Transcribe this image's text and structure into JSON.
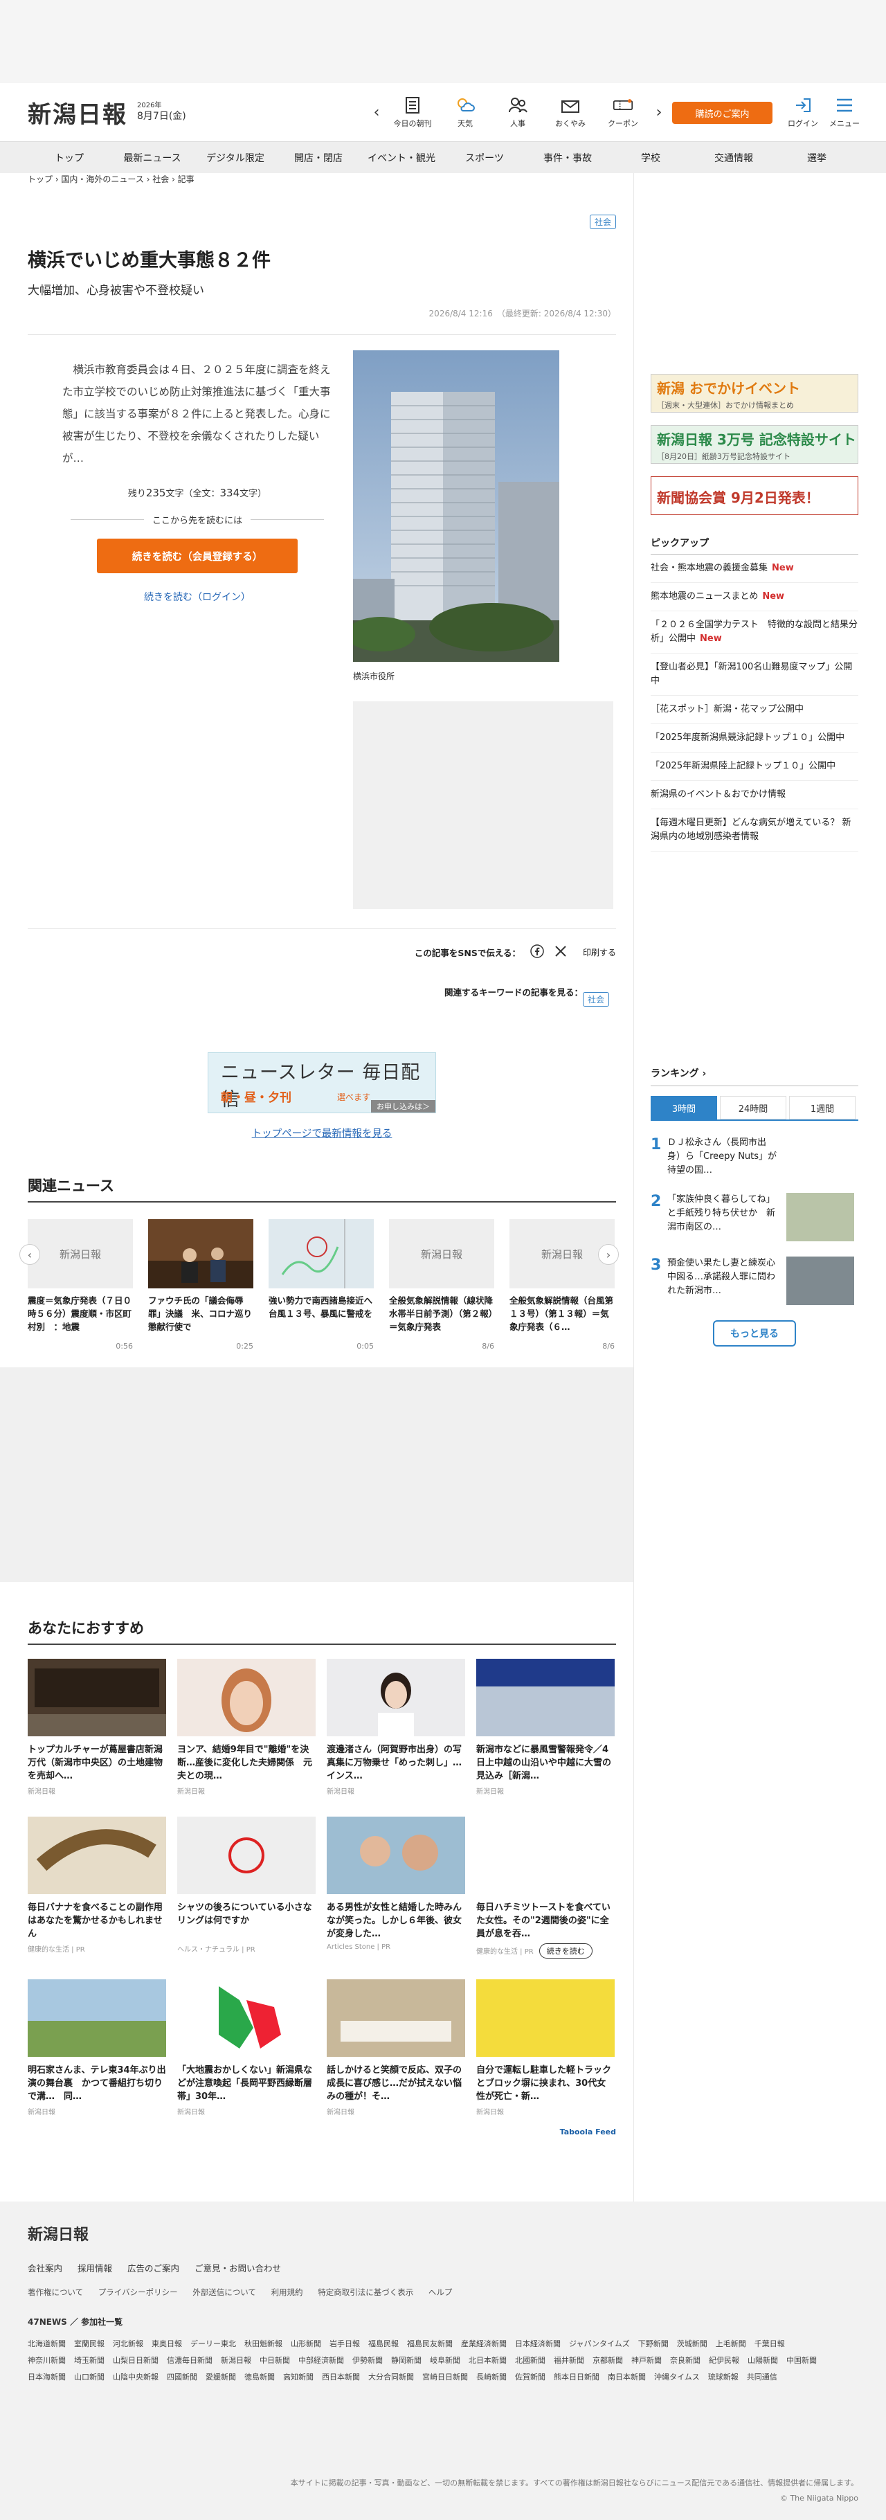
{
  "header": {
    "logo": "新潟日報",
    "date_year": "2026年",
    "date_day": "8月7日(金)",
    "icons": [
      {
        "label": "今日の朝刊",
        "icon": "newspaper-icon"
      },
      {
        "label": "天気",
        "icon": "weather-icon"
      },
      {
        "label": "人事",
        "icon": "people-icon"
      },
      {
        "label": "おくやみ",
        "icon": "mail-icon"
      },
      {
        "label": "クーポン",
        "icon": "coupon-icon"
      }
    ],
    "subscribe": "購読のご案内",
    "login": "ログイン",
    "menu": "メニュー",
    "accent": "#ee6c12"
  },
  "nav": [
    "トップ",
    "最新ニュース",
    "デジタル限定",
    "開店・閉店",
    "イベント・観光",
    "スポーツ",
    "事件・事故",
    "学校",
    "交通情報",
    "選挙"
  ],
  "article": {
    "breadcrumb": "トップ › 国内・海外のニュース › 社会 › 記事",
    "category": "社会",
    "title": "横浜でいじめ重大事態８２件",
    "subtitle": "大幅増加、心身被害や不登校疑い",
    "published": "2026/8/4 12:16　（最終更新: 2026/8/4 12:30）",
    "lead": "横浜市教育委員会は４日、２０２５年度に調査を終えた市立学校でのいじめ防止対策推進法に基づく「重大事態」に該当する事案が８２件に上ると発表した。心身に被害が生じたり、不登校を余儀なくされたりした疑いが…",
    "count_prefix": "残り",
    "count_remaining": "235",
    "count_mid": "文字（全文：",
    "count_total": "334",
    "count_suffix": "文字）",
    "read_more_label": "ここから先を読むには",
    "register_button": "続きを読む（会員登録する）",
    "login_button": "続きを読む（ログイン）",
    "photo_caption": "横浜市役所",
    "sns_label": "この記事をSNSで伝える：",
    "print_label": "印刷する",
    "keyword_label": "関連するキーワードの記事を見る：",
    "keyword": "社会"
  },
  "newsletter": {
    "title": "ニュースレター 毎日配信",
    "times": "朝・昼・夕刊",
    "choose": "選べます",
    "apply": "お申し込みは＞"
  },
  "top_link": "トップページで最新情報を見る",
  "related": {
    "title": "関連ニュース",
    "cards": [
      {
        "thumb": "新潟日報",
        "title": "震度＝気象庁発表（７日０時５６分）震度順・市区町村別　：地震",
        "time": "0:56"
      },
      {
        "thumb": "",
        "title": "ファウチ氏の「議会侮辱罪」決議　米、コロナ巡り懲献行使で",
        "time": "0:25"
      },
      {
        "thumb": "",
        "title": "強い勢力で南西諸島接近へ　台風１３号、暴風に警戒を",
        "time": "0:05"
      },
      {
        "thumb": "新潟日報",
        "title": "全般気象解説情報（線状降水帯半日前予測）（第２報）＝気象庁発表",
        "time": "8/6"
      },
      {
        "thumb": "新潟日報",
        "title": "全般気象解説情報（台風第１３号）（第１３報）＝気象庁発表（６…",
        "time": "8/6"
      }
    ]
  },
  "sidebar": {
    "banners": [
      {
        "main": "新潟 おでかけイベント",
        "sub": "［週末・大型連休］おでかけ情報まとめ"
      },
      {
        "main": "新潟日報 3万号 記念特設サイト",
        "sub": "［8月20日］紙齢3万号記念特設サイト"
      },
      {
        "main": "新聞協会賞 9月2日発表！",
        "sub": ""
      }
    ],
    "pickup_title": "ピックアップ",
    "pickup": [
      {
        "text": "社会・熊本地震の義援金募集",
        "new": "New"
      },
      {
        "text": "熊本地震のニュースまとめ",
        "new": "New"
      },
      {
        "text": "「２０２６全国学力テスト　特徴的な設問と結果分析」公開中",
        "new": "New"
      },
      {
        "text": "【登山者必見】「新潟100名山難易度マップ」公開中",
        "new": ""
      },
      {
        "text": "［花スポット］新潟・花マップ公開中",
        "new": ""
      },
      {
        "text": "「2025年度新潟県競泳記録トップ１０」公開中",
        "new": ""
      },
      {
        "text": "「2025年新潟県陸上記録トップ１０」公開中",
        "new": ""
      },
      {
        "text": "新潟県のイベント＆おでかけ情報",
        "new": ""
      },
      {
        "text": "【毎週木曜日更新】どんな病気が増えている？ 新潟県内の地域別感染者情報",
        "new": ""
      }
    ],
    "ranking_title": "ランキング ›",
    "ranking_tabs": [
      "3時間",
      "24時間",
      "1週間"
    ],
    "ranking": [
      {
        "num": "1",
        "text": "ＤＪ松永さん（長岡市出身）ら「Creepy Nuts」が待望の国…"
      },
      {
        "num": "2",
        "text": "「家族仲良く暮らしてね」と手紙残り特ち伏せか　新潟市南区の…"
      },
      {
        "num": "3",
        "text": "預金使い果たし妻と練炭心中図る…承諾殺人罪に問われた新潟市…"
      }
    ],
    "more_button": "もっと見る"
  },
  "recommend": {
    "title": "あなたにおすすめ",
    "cards": [
      {
        "title": "トップカルチャーが蔦屋書店新潟万代（新潟市中央区）の土地建物を売却へ…",
        "source": "新潟日報"
      },
      {
        "title": "ヨンア、結婚9年目で\"離婚\"を決断…産後に変化した夫婦関係　元夫との現…",
        "source": "新潟日報"
      },
      {
        "title": "渡邊渚さん（阿賀野市出身）の写真集に万物乗せ「めった刺し」…インス…",
        "source": "新潟日報"
      },
      {
        "title": "新潟市などに暴風雪警報発令／4日上中越の山沿いや中越に大雪の見込み［新潟…",
        "source": "新潟日報"
      },
      {
        "title": "毎日バナナを食べることの副作用はあなたを驚かせるかもしれません",
        "source": "健康的な生活 | PR"
      },
      {
        "title": "シャツの後ろについている小さなリングは何ですか",
        "source": "ヘルス・ナチュラル | PR"
      },
      {
        "title": "ある男性が女性と結婚した時みんなが笑った。しかし６年後、彼女が変身した…",
        "source": "Articles Stone | PR"
      },
      {
        "title": "毎日ハチミツトーストを食べていた女性。その\"2週間後の姿\"に全員が息を吞…",
        "source": "健康的な生活 | PR",
        "continue": "続きを読む"
      },
      {
        "title": "明石家さんま、テレ東34年ぶり出演の舞台裏　かつて番組打ち切りで溝…　同…",
        "source": "新潟日報"
      },
      {
        "title": "「大地震おかしくない」新潟県などが注意喚起「長岡平野西縁断層帯」30年…",
        "source": "新潟日報"
      },
      {
        "title": "話しかけると笑顔で反応、双子の成長に喜び感じ…だが拭えない悩みの種が！そ…",
        "source": "新潟日報"
      },
      {
        "title": "自分で運転し駐車した軽トラックとブロック塀に挟まれ、30代女性が死亡・新…",
        "source": "新潟日報"
      }
    ],
    "taboola": "Taboola Feed"
  },
  "footer": {
    "logo": "新潟日報",
    "links1": [
      "会社案内",
      "採用情報",
      "広告のご案内",
      "ご意見・お問い合わせ"
    ],
    "links2": [
      "著作権について",
      "プライバシーポリシー",
      "外部送信について",
      "利用規約",
      "特定商取引法に基づく表示",
      "ヘルプ"
    ],
    "network": "47NEWS ／ 参加社一覧",
    "papers": [
      "北海道新聞",
      "室蘭民報",
      "河北新報",
      "東奥日報",
      "デーリー東北",
      "秋田魁新報",
      "山形新聞",
      "岩手日報",
      "福島民報",
      "福島民友新聞",
      "産業経済新聞",
      "日本経済新聞",
      "ジャパンタイムズ",
      "下野新聞",
      "茨城新聞",
      "上毛新聞",
      "千葉日報",
      "神奈川新聞",
      "埼玉新聞",
      "山梨日日新聞",
      "信濃毎日新聞",
      "新潟日報",
      "中日新聞",
      "中部経済新聞",
      "伊勢新聞",
      "静岡新聞",
      "岐阜新聞",
      "北日本新聞",
      "北國新聞",
      "福井新聞",
      "京都新聞",
      "神戸新聞",
      "奈良新聞",
      "紀伊民報",
      "山陽新聞",
      "中国新聞",
      "日本海新聞",
      "山口新聞",
      "山陰中央新報",
      "四國新聞",
      "愛媛新聞",
      "徳島新聞",
      "高知新聞",
      "西日本新聞",
      "大分合同新聞",
      "宮崎日日新聞",
      "長崎新聞",
      "佐賀新聞",
      "熊本日日新聞",
      "南日本新聞",
      "沖縄タイムス",
      "琉球新報",
      "共同通信"
    ],
    "notice": "本サイトに掲載の記事・写真・動画など、一切の無断転載を禁じます。すべての著作権は新潟日報社ならびにニュース配信元である通信社、情報提供者に帰属します。",
    "copyright": "© The Niigata Nippo"
  }
}
